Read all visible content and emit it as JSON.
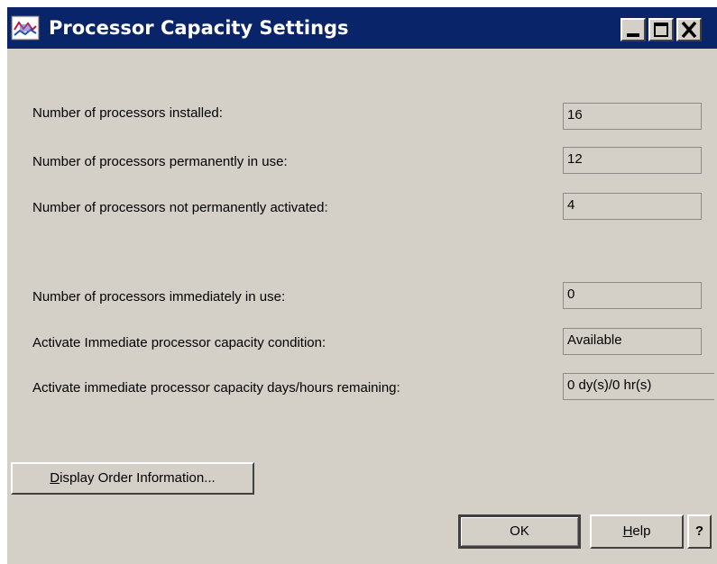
{
  "window": {
    "title": "Processor Capacity Settings",
    "icon": "app-icon",
    "controls": [
      "minimize-icon",
      "maximize-icon",
      "close-icon"
    ]
  },
  "fields": [
    {
      "label": "Number of processors installed:",
      "value": "16"
    },
    {
      "label": "Number of processors permanently in use:",
      "value": "12"
    },
    {
      "label": "Number of processors not permanently activated:",
      "value": "4"
    },
    {
      "label": "Number of processors  immediately in use:",
      "value": "0"
    },
    {
      "label": "Activate Immediate  processor  capacity condition:",
      "value": "Available"
    },
    {
      "label": "Activate immediate processor capacity days/hours  remaining:",
      "value": "0 dy(s)/0 hr(s)"
    }
  ],
  "buttons": {
    "display_order": {
      "mnemonic": "D",
      "rest": "isplay Order Information..."
    },
    "ok": "OK",
    "help": {
      "mnemonic": "H",
      "rest": "elp"
    },
    "question": "?"
  },
  "colors": {
    "titlebar": "#0a246a",
    "face": "#d4d0c8",
    "title_text": "#ffffff"
  }
}
